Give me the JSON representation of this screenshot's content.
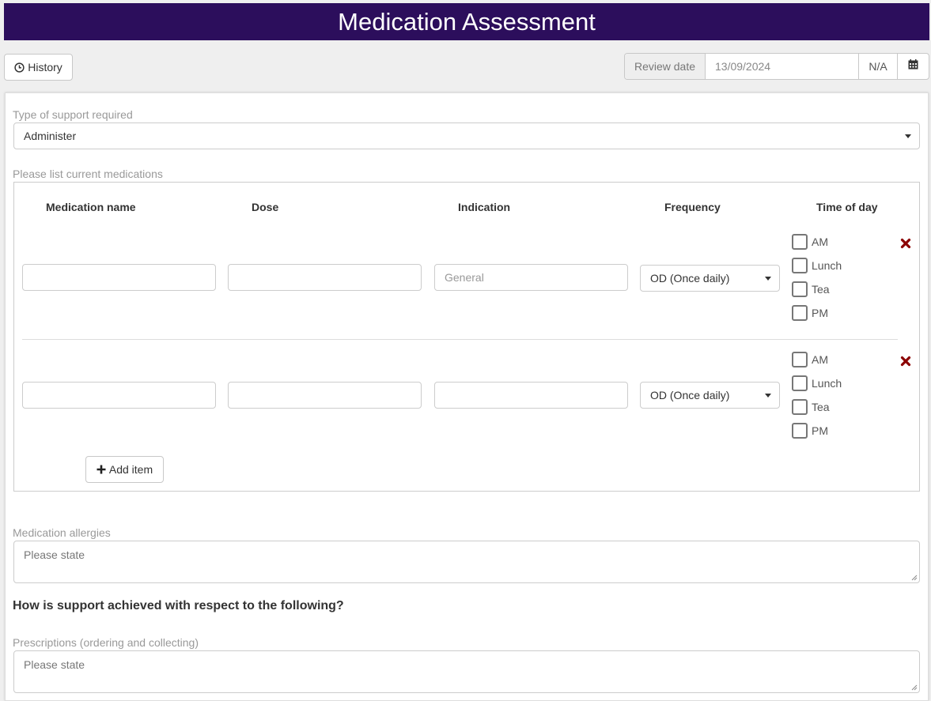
{
  "header": {
    "title": "Medication Assessment"
  },
  "toolbar": {
    "history_label": "History",
    "review_date_label": "Review date",
    "review_date_value": "13/09/2024",
    "na_label": "N/A"
  },
  "support": {
    "label": "Type of support required",
    "value": "Administer"
  },
  "medications": {
    "label": "Please list current medications",
    "columns": [
      "Medication name",
      "Dose",
      "Indication",
      "Frequency",
      "Time of day"
    ],
    "rows": [
      {
        "name": "",
        "dose": "",
        "indication_placeholder": "General",
        "frequency": "OD (Once daily)",
        "times": [
          "AM",
          "Lunch",
          "Tea",
          "PM"
        ]
      },
      {
        "name": "",
        "dose": "",
        "indication_placeholder": "",
        "frequency": "OD (Once daily)",
        "times": [
          "AM",
          "Lunch",
          "Tea",
          "PM"
        ]
      }
    ],
    "add_label": "Add item"
  },
  "allergies": {
    "label": "Medication allergies",
    "placeholder": "Please state"
  },
  "section_question": "How is support achieved with respect to the following?",
  "prescriptions": {
    "label": "Prescriptions (ordering and collecting)",
    "placeholder": "Please state"
  },
  "colors": {
    "title_bg": "#2c0e5c",
    "delete_icon": "#8b0000"
  }
}
